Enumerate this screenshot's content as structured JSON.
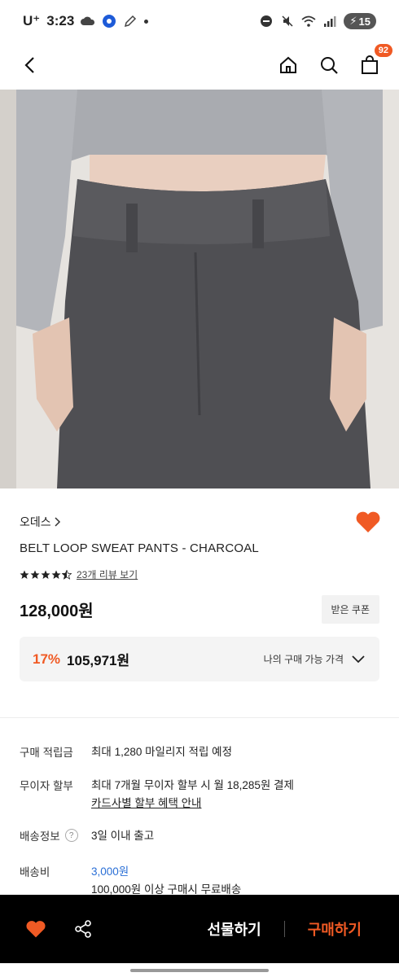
{
  "status": {
    "carrier": "U⁺",
    "time": "3:23",
    "battery": "15"
  },
  "header": {
    "back_icon": "chevron-left-icon",
    "home_icon": "home-icon",
    "search_icon": "search-icon",
    "cart_icon": "shopping-bag-icon",
    "cart_count": "92"
  },
  "product": {
    "brand": "오데스",
    "title": "BELT LOOP SWEAT PANTS - CHARCOAL",
    "rating": 4.5,
    "review_link": "23개 리뷰 보기",
    "price": "128,000원",
    "coupon_label": "받은 쿠폰",
    "discount_rate": "17%",
    "discount_price": "105,971원",
    "my_price_label": "나의 구매 가능 가격"
  },
  "info": {
    "points_label": "구매 적립금",
    "points_value": "최대 1,280 마일리지 적립 예정",
    "installment_label": "무이자 할부",
    "installment_value": "최대 7개월 무이자 할부 시 월 18,285원 결제",
    "installment_link": "카드사별 할부 혜택 안내",
    "shipping_info_label": "배송정보",
    "shipping_info_value": "3일 이내 출고",
    "shipping_fee_label": "배송비",
    "shipping_fee_value": "3,000원",
    "shipping_fee_note": "100,000원 이상 구매시 무료배송"
  },
  "bottom": {
    "gift_label": "선물하기",
    "buy_label": "구매하기"
  },
  "colors": {
    "accent": "#f05a24",
    "link_blue": "#2a6fd6"
  }
}
